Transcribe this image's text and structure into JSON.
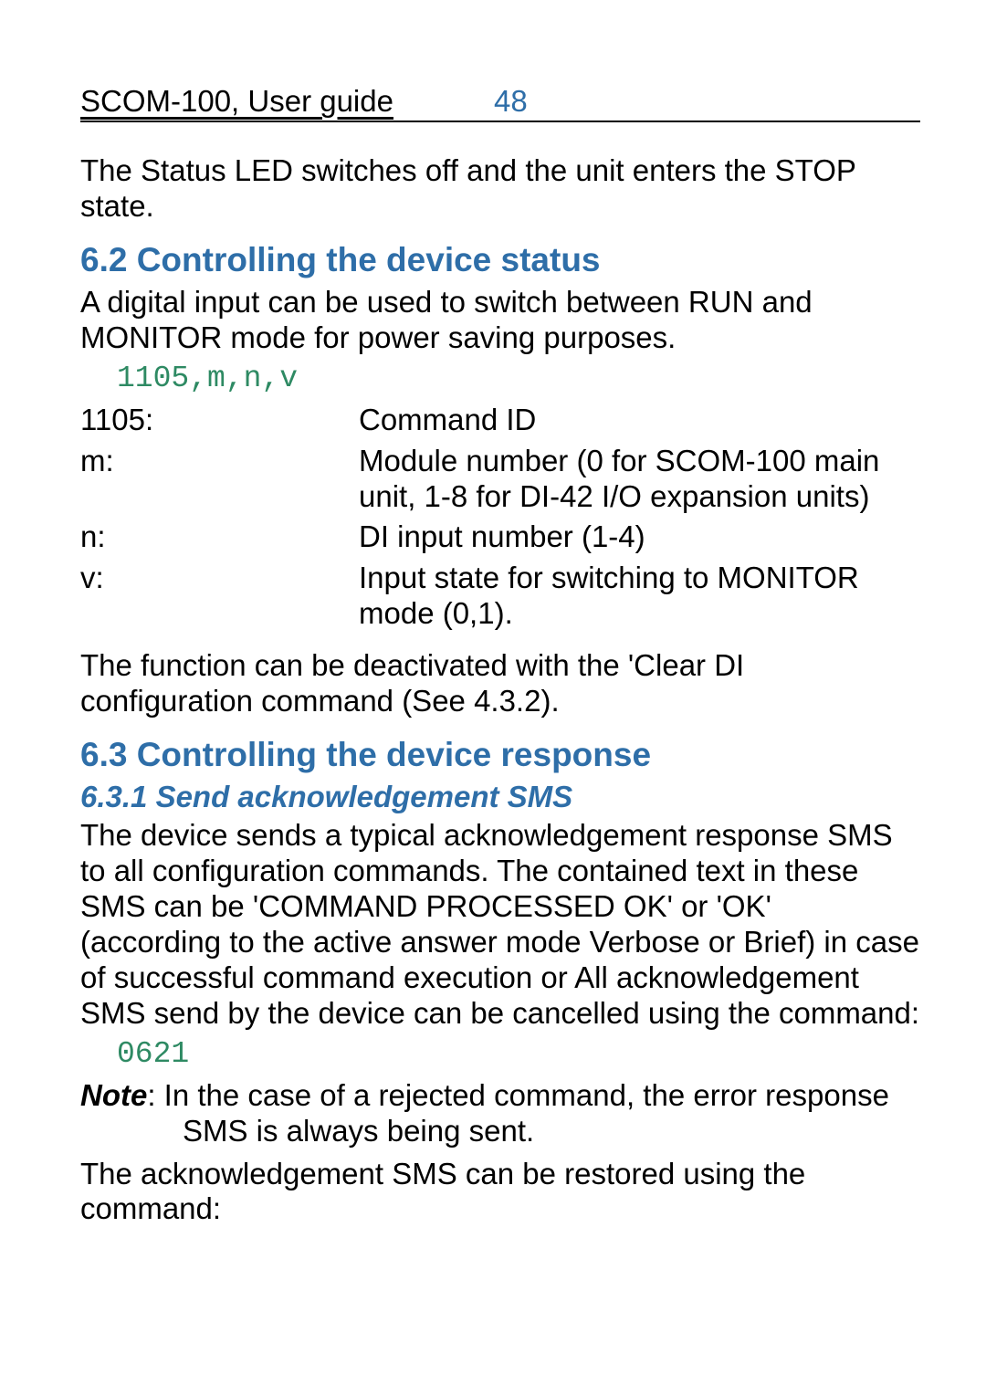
{
  "header": {
    "title": "SCOM-100, User guide",
    "page": "48"
  },
  "intro": "The Status LED switches off and the unit enters the STOP state.",
  "sec62": {
    "heading": "6.2 Controlling the device status",
    "text": "A digital input can be used to switch between RUN and MONITOR mode for power saving purposes.",
    "code": "1105,m,n,v",
    "params": [
      {
        "k": "1105:",
        "v": "Command ID"
      },
      {
        "k": "m:",
        "v": "Module number (0 for SCOM-100 main unit, 1-8 for DI-42 I/O expansion units)"
      },
      {
        "k": "n:",
        "v": "DI input number (1-4)"
      },
      {
        "k": "v:",
        "v": "Input state for switching to MONITOR mode (0,1)."
      }
    ],
    "tail": "The function can be deactivated with the 'Clear DI configuration command (See 4.3.2)."
  },
  "sec63": {
    "heading": " 6.3 Controlling the device response",
    "sub": {
      "heading": "6.3.1 Send acknowledgement SMS",
      "body": "The device sends a typical acknowledgement response SMS to all configuration commands. The contained text in these SMS can be  'COMMAND PROCESSED OK' or 'OK' (according to the active answer mode Verbose or Brief) in case of successful command execution or All acknowledgement SMS send by the device can be cancelled using the command:",
      "code": "0621",
      "note_label": "Note",
      "note_text": ": In the case of a rejected command, the error response SMS is always being sent.",
      "tail": "The acknowledgement SMS can be restored using the command:"
    }
  }
}
